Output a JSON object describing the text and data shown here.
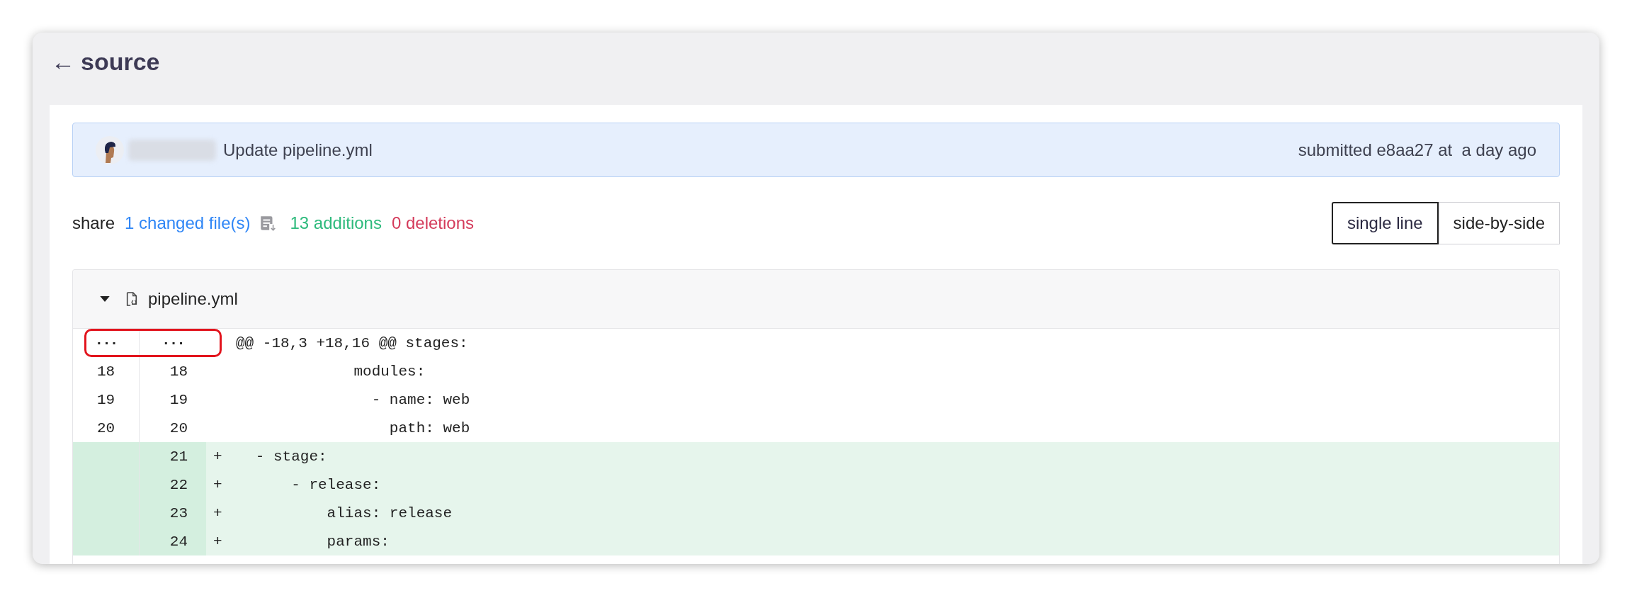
{
  "page": {
    "back_arrow": "←",
    "title": "source"
  },
  "commit": {
    "message": "Update pipeline.yml",
    "submitted": "submitted e8aa27 at  a day ago"
  },
  "summary": {
    "share": "share",
    "changed_files": "1 changed file(s)",
    "additions": "13 additions",
    "deletions": "0 deletions"
  },
  "view_modes": [
    {
      "label": "single line",
      "selected": true
    },
    {
      "label": "side-by-side",
      "selected": false
    }
  ],
  "file": {
    "name": "pipeline.yml",
    "expanded": true,
    "lines": [
      {
        "kind": "hunk",
        "old": "···",
        "new": "···",
        "text": "@@ -18,3 +18,16 @@ stages:",
        "highlighted": true
      },
      {
        "kind": "context",
        "old": "18",
        "new": "18",
        "text": "              modules:",
        "highlighted": false
      },
      {
        "kind": "context",
        "old": "19",
        "new": "19",
        "text": "                - name: web",
        "highlighted": false
      },
      {
        "kind": "context",
        "old": "20",
        "new": "20",
        "text": "                  path: web",
        "highlighted": false
      },
      {
        "kind": "added",
        "new": "21",
        "prefix": "+",
        "text": "   - stage:",
        "highlighted": false
      },
      {
        "kind": "added",
        "new": "22",
        "prefix": "+",
        "text": "       - release:",
        "highlighted": false
      },
      {
        "kind": "added",
        "new": "23",
        "prefix": "+",
        "text": "           alias: release",
        "highlighted": false
      },
      {
        "kind": "added",
        "new": "24",
        "prefix": "+",
        "text": "           params:",
        "highlighted": false
      }
    ]
  }
}
